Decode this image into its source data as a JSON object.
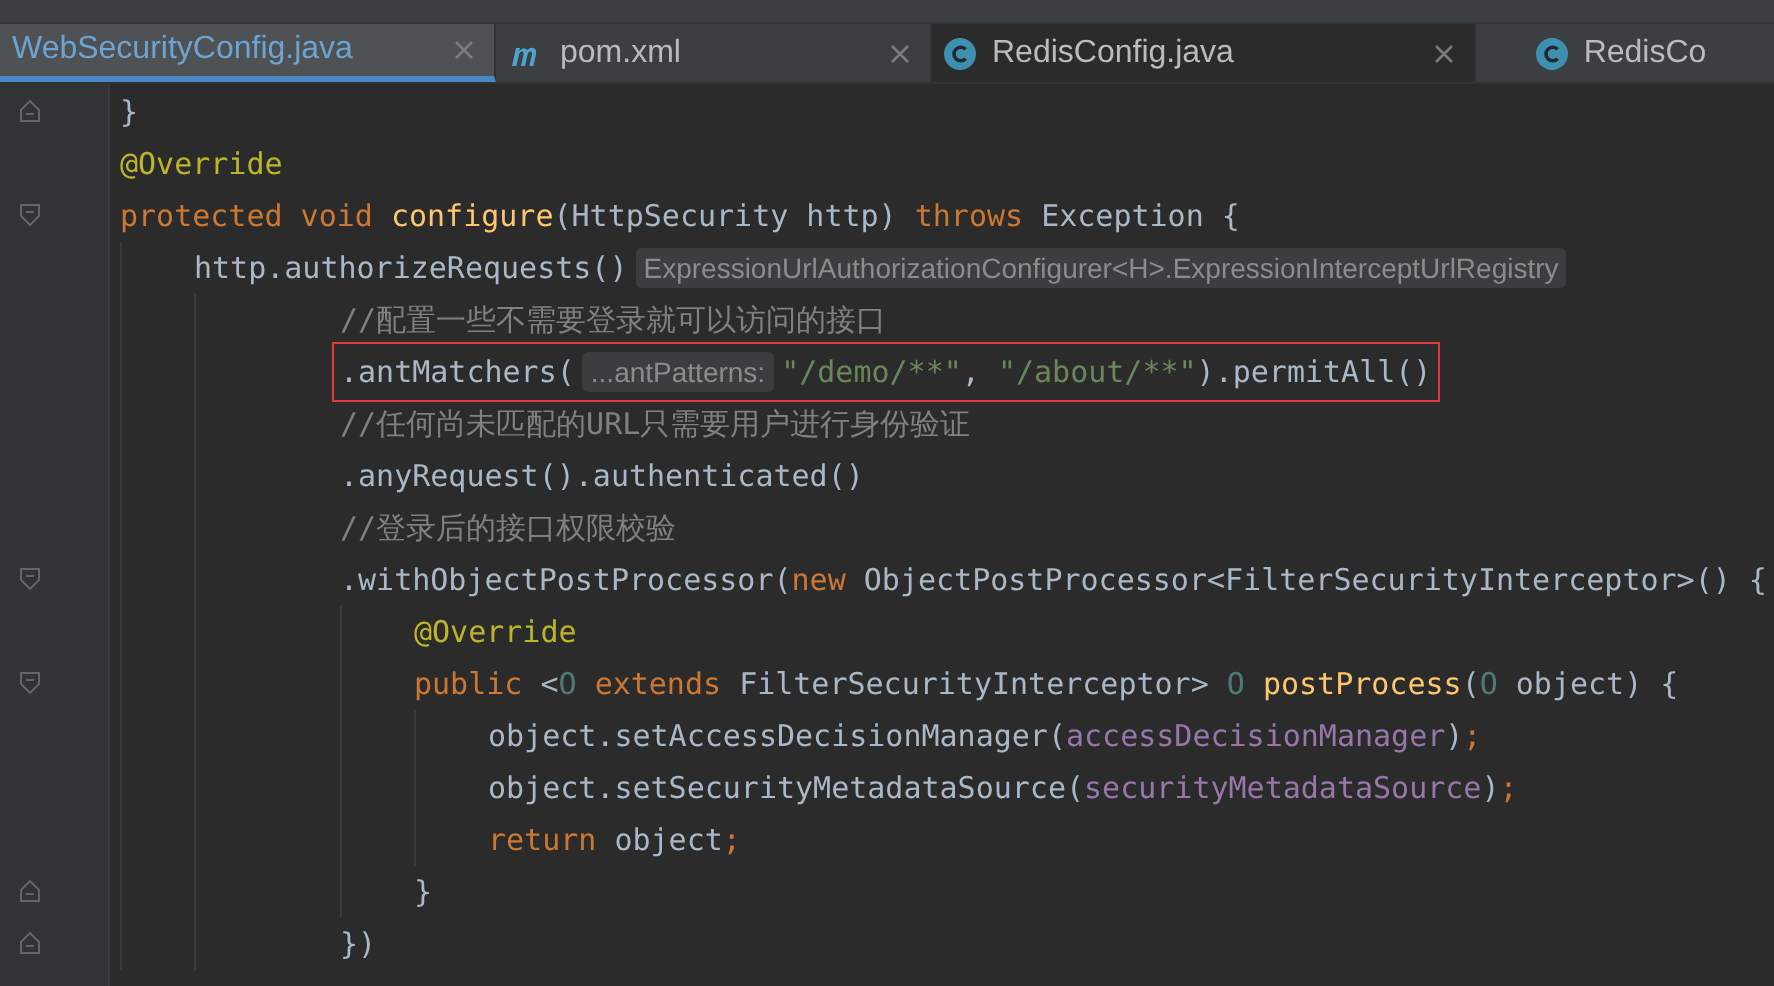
{
  "tabs": [
    {
      "label": "WebSecurityConfig.java",
      "kind": "plain",
      "selected": true
    },
    {
      "label": "pom.xml",
      "kind": "maven",
      "selected": false
    },
    {
      "label": "RedisConfig.java",
      "kind": "class",
      "selected": false
    },
    {
      "label": "RedisCo",
      "kind": "class",
      "selected": false
    }
  ],
  "code_lines": [
    {
      "kind": "fold-end",
      "tokens": [
        {
          "kind": "plain",
          "text": "}"
        }
      ]
    },
    {
      "tokens": [
        {
          "kind": "annotation",
          "text": "@Override"
        }
      ]
    },
    {
      "kind": "fold-start",
      "tokens": [
        {
          "kind": "keyword",
          "text": "protected void "
        },
        {
          "kind": "method",
          "text": "configure"
        },
        {
          "kind": "plain",
          "text": "(HttpSecurity http) "
        },
        {
          "kind": "keyword",
          "text": "throws "
        },
        {
          "kind": "plain",
          "text": "Exception {"
        }
      ],
      "children": [
        {
          "continuation": true,
          "tokens": [
            {
              "kind": "plain",
              "text": "http.authorizeRequests()"
            },
            {
              "kind": "hint",
              "text": "ExpressionUrlAuthorizationConfigurer<H>.ExpressionInterceptUrlRegistry"
            }
          ],
          "children": [
            {
              "tokens": [
                {
                  "kind": "comment",
                  "text": "//配置一些不需要登录就可以访问的接口"
                }
              ]
            },
            {
              "highlighted": true,
              "tokens": [
                {
                  "kind": "plain",
                  "text": ".antMatchers("
                },
                {
                  "kind": "hint",
                  "text": "...antPatterns:"
                },
                {
                  "kind": "string",
                  "text": "\"/demo/**\""
                },
                {
                  "kind": "plain",
                  "text": ", "
                },
                {
                  "kind": "string",
                  "text": "\"/about/**\""
                },
                {
                  "kind": "plain",
                  "text": ").permitAll()"
                }
              ]
            },
            {
              "tokens": [
                {
                  "kind": "comment",
                  "text": "//任何尚未匹配的URL只需要用户进行身份验证"
                }
              ]
            },
            {
              "tokens": [
                {
                  "kind": "plain",
                  "text": ".anyRequest().authenticated()"
                }
              ]
            },
            {
              "tokens": [
                {
                  "kind": "comment",
                  "text": "//登录后的接口权限校验"
                }
              ]
            },
            {
              "kind": "fold-start",
              "tokens": [
                {
                  "kind": "plain",
                  "text": ".withObjectPostProcessor("
                },
                {
                  "kind": "keyword",
                  "text": "new "
                },
                {
                  "kind": "plain",
                  "text": "ObjectPostProcessor<FilterSecurityInterceptor>() {"
                }
              ],
              "children": [
                {
                  "tokens": [
                    {
                      "kind": "annotation",
                      "text": "@Override"
                    }
                  ]
                },
                {
                  "kind": "fold-start",
                  "tokens": [
                    {
                      "kind": "keyword",
                      "text": "public "
                    },
                    {
                      "kind": "plain",
                      "text": "<"
                    },
                    {
                      "kind": "typeparam",
                      "text": "O "
                    },
                    {
                      "kind": "keyword",
                      "text": "extends "
                    },
                    {
                      "kind": "plain",
                      "text": "FilterSecurityInterceptor> "
                    },
                    {
                      "kind": "typeparam",
                      "text": "O "
                    },
                    {
                      "kind": "method",
                      "text": "postProcess"
                    },
                    {
                      "kind": "plain",
                      "text": "("
                    },
                    {
                      "kind": "typeparam",
                      "text": "O "
                    },
                    {
                      "kind": "plain",
                      "text": "object) {"
                    }
                  ],
                  "children": [
                    {
                      "tokens": [
                        {
                          "kind": "plain",
                          "text": "object.setAccessDecisionManager("
                        },
                        {
                          "kind": "field",
                          "text": "accessDecisionManager"
                        },
                        {
                          "kind": "plain",
                          "text": ")"
                        },
                        {
                          "kind": "keyword",
                          "text": ";"
                        }
                      ]
                    },
                    {
                      "tokens": [
                        {
                          "kind": "plain",
                          "text": "object.setSecurityMetadataSource("
                        },
                        {
                          "kind": "field",
                          "text": "securityMetadataSource"
                        },
                        {
                          "kind": "plain",
                          "text": ")"
                        },
                        {
                          "kind": "keyword",
                          "text": ";"
                        }
                      ]
                    },
                    {
                      "tokens": [
                        {
                          "kind": "keyword",
                          "text": "return "
                        },
                        {
                          "kind": "plain",
                          "text": "object"
                        },
                        {
                          "kind": "keyword",
                          "text": ";"
                        }
                      ]
                    }
                  ]
                },
                {
                  "kind": "fold-end",
                  "tokens": [
                    {
                      "kind": "plain",
                      "text": "}"
                    }
                  ]
                }
              ]
            },
            {
              "kind": "fold-end",
              "tokens": [
                {
                  "kind": "plain",
                  "text": "})"
                }
              ]
            }
          ]
        }
      ]
    }
  ]
}
